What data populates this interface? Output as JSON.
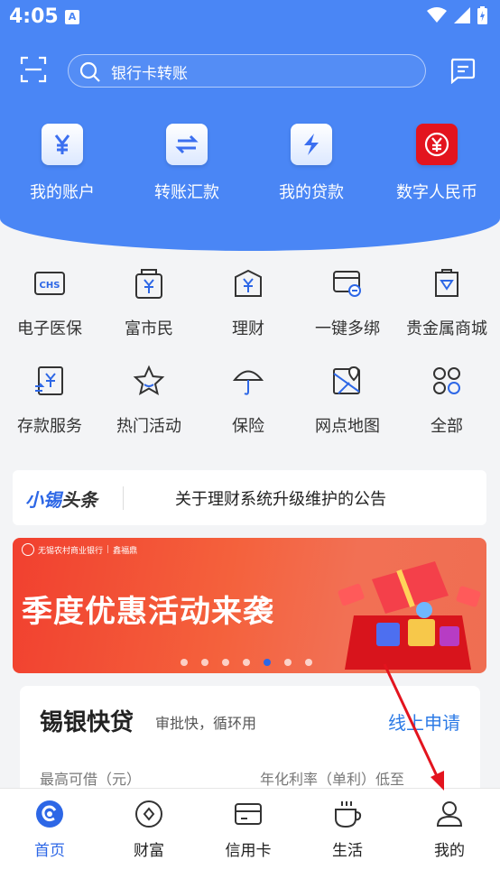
{
  "status": {
    "time": "4:05",
    "notif_letter": "A"
  },
  "search": {
    "placeholder": "银行卡转账"
  },
  "quick_actions": [
    {
      "label": "我的账户",
      "icon": "yuan-icon"
    },
    {
      "label": "转账汇款",
      "icon": "transfer-icon"
    },
    {
      "label": "我的贷款",
      "icon": "lightning-icon"
    },
    {
      "label": "数字人民币",
      "icon": "digital-rmb-icon"
    }
  ],
  "services": [
    {
      "label": "电子医保",
      "icon": "chs-icon",
      "badge": "CHS"
    },
    {
      "label": "富市民",
      "icon": "wallet-yuan-icon"
    },
    {
      "label": "理财",
      "icon": "wealth-icon"
    },
    {
      "label": "一键多绑",
      "icon": "card-link-icon"
    },
    {
      "label": "贵金属商城",
      "icon": "precious-metal-icon"
    },
    {
      "label": "存款服务",
      "icon": "deposit-icon"
    },
    {
      "label": "热门活动",
      "icon": "star-icon"
    },
    {
      "label": "保险",
      "icon": "umbrella-icon"
    },
    {
      "label": "网点地图",
      "icon": "map-icon"
    },
    {
      "label": "全部",
      "icon": "grid-icon"
    }
  ],
  "notice": {
    "brand_main": "小锡",
    "brand_sub": "头条",
    "text": "关于理财系统升级维护的公告"
  },
  "banner": {
    "bank_name": "无锡农村商业银行",
    "sub_brand": "鑫福鼎",
    "title": "季度优惠活动来袭",
    "active_dot": 4,
    "dot_count": 7
  },
  "loan_card": {
    "title": "锡银快贷",
    "subtitle": "审批快，循环用",
    "link": "线上申请",
    "left_label": "最高可借（元）",
    "right_label": "年化利率（单利）低至"
  },
  "tabs": [
    {
      "label": "首页",
      "icon": "home-icon",
      "active": true
    },
    {
      "label": "财富",
      "icon": "wealth-tab-icon"
    },
    {
      "label": "信用卡",
      "icon": "credit-card-icon"
    },
    {
      "label": "生活",
      "icon": "coffee-icon"
    },
    {
      "label": "我的",
      "icon": "user-icon"
    }
  ],
  "colors": {
    "primary": "#4a86f5",
    "accent": "#2d67e6",
    "arrow": "#e3141e"
  }
}
